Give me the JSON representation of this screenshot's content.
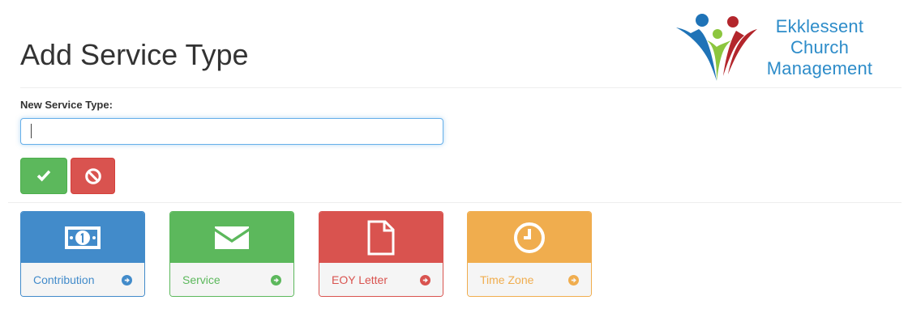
{
  "header": {
    "title": "Add Service Type",
    "logo": {
      "line1": "Ekklessent",
      "line2": "Church",
      "line3": "Management",
      "colors": {
        "blue": "#1f73b7",
        "red": "#b3262c",
        "green": "#8cc63f",
        "text": "#2d8cc9"
      }
    }
  },
  "form": {
    "label": "New Service Type:",
    "input_value": "",
    "input_placeholder": "",
    "save_icon": "check-icon",
    "cancel_icon": "ban-icon"
  },
  "tiles": [
    {
      "label": "Contribution",
      "icon": "money-icon",
      "color": "#428bca"
    },
    {
      "label": "Service",
      "icon": "envelope-icon",
      "color": "#5cb85c"
    },
    {
      "label": "EOY Letter",
      "icon": "file-icon",
      "color": "#d9534f"
    },
    {
      "label": "Time Zone",
      "icon": "clock-icon",
      "color": "#f0ad4e"
    }
  ]
}
